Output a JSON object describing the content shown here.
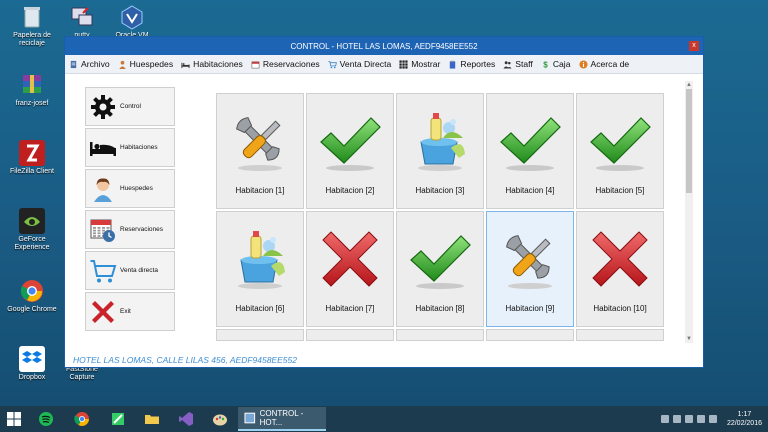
{
  "desktop": {
    "icons": [
      {
        "label": "Papelera de reciclaje",
        "icon": "recycle-bin-icon"
      },
      {
        "label": "putty",
        "icon": "putty-icon"
      },
      {
        "label": "Oracle VM",
        "icon": "virtualbox-icon"
      },
      {
        "label": "franz-josef",
        "icon": "winrar-icon"
      },
      {
        "label": "FileZilla Client",
        "icon": "filezilla-icon"
      },
      {
        "label": "GeForce Experience",
        "icon": "nvidia-icon"
      },
      {
        "label": "Google Chrome",
        "icon": "chrome-icon"
      },
      {
        "label": "Dropbox",
        "icon": "dropbox-icon"
      },
      {
        "label": "FastStone Capture",
        "icon": "faststone-icon"
      }
    ]
  },
  "window": {
    "title": "CONTROL - HOTEL LAS LOMAS, AEDF9458EE552",
    "close": "x"
  },
  "menu": {
    "items": [
      {
        "label": "Archivo",
        "icon": "document-icon",
        "color": "#4a6fa5"
      },
      {
        "label": "Huespedes",
        "icon": "person-icon",
        "color": "#c9773a"
      },
      {
        "label": "Habitaciones",
        "icon": "bed-icon",
        "color": "#333333"
      },
      {
        "label": "Reservaciones",
        "icon": "calendar-icon",
        "color": "#c23b3b"
      },
      {
        "label": "Venta Directa",
        "icon": "cart-icon",
        "color": "#3a86c9"
      },
      {
        "label": "Mostrar",
        "icon": "grid-icon",
        "color": "#222222"
      },
      {
        "label": "Reportes",
        "icon": "clipboard-icon",
        "color": "#3a66c9"
      },
      {
        "label": "Staff",
        "icon": "people-icon",
        "color": "#333333"
      },
      {
        "label": "Caja",
        "icon": "dollar-icon",
        "color": "#2e9b3c"
      },
      {
        "label": "Acerca de",
        "icon": "info-icon",
        "color": "#e07d20"
      }
    ]
  },
  "nav": {
    "buttons": [
      {
        "label": "Control",
        "icon": "gear-icon"
      },
      {
        "label": "Habitaciones",
        "icon": "bed-icon"
      },
      {
        "label": "Huespedes",
        "icon": "person-icon"
      },
      {
        "label": "Reservaciones",
        "icon": "calendar-icon"
      },
      {
        "label": "Venta directa",
        "icon": "cart-icon"
      },
      {
        "label": "Exit",
        "icon": "red-x-icon"
      }
    ]
  },
  "rooms": [
    {
      "label": "Habitacion [1]",
      "status": "maintenance"
    },
    {
      "label": "Habitacion [2]",
      "status": "available"
    },
    {
      "label": "Habitacion [3]",
      "status": "cleaning"
    },
    {
      "label": "Habitacion [4]",
      "status": "available"
    },
    {
      "label": "Habitacion [5]",
      "status": "available"
    },
    {
      "label": "Habitacion [6]",
      "status": "cleaning"
    },
    {
      "label": "Habitacion [7]",
      "status": "occupied"
    },
    {
      "label": "Habitacion [8]",
      "status": "available"
    },
    {
      "label": "Habitacion [9]",
      "status": "maintenance",
      "selected": true
    },
    {
      "label": "Habitacion [10]",
      "status": "occupied"
    }
  ],
  "footer": "HOTEL LAS LOMAS, CALLE LILAS 456, AEDF9458EE552",
  "taskbar": {
    "task_label": "CONTROL - HOT...",
    "time": "1:17",
    "date": "22/02/2016"
  }
}
